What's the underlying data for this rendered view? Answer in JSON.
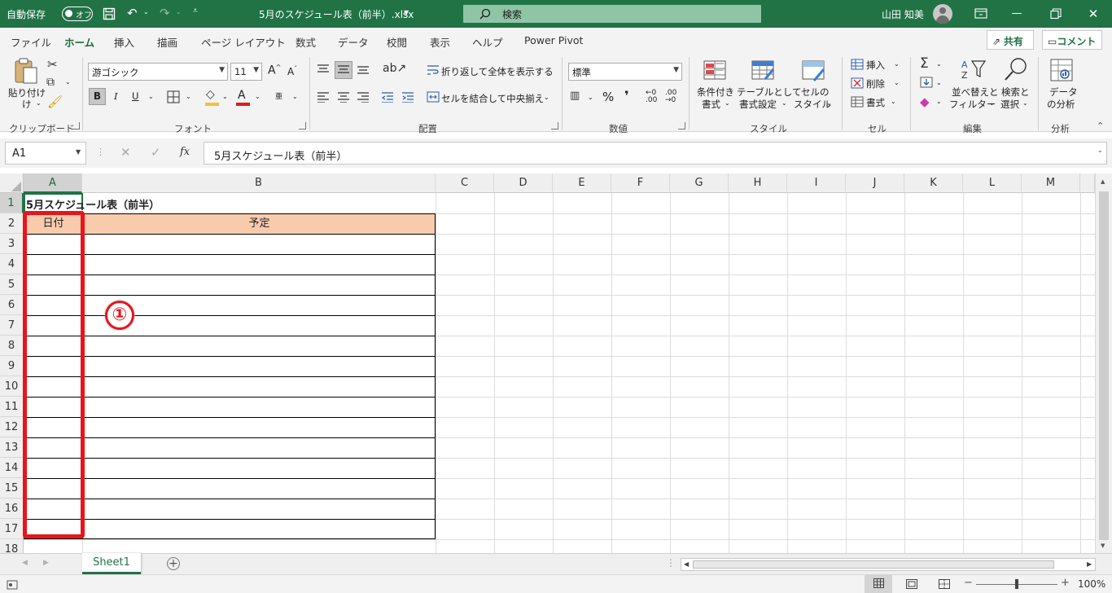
{
  "titlebar": {
    "autosave_label": "自動保存",
    "autosave_state": "オフ",
    "doc_title": "5月のスケジュール表（前半）.xlsx",
    "search_placeholder": "検索",
    "user_name": "山田 知美"
  },
  "menu": {
    "tabs": [
      "ファイル",
      "ホーム",
      "挿入",
      "描画",
      "ページ レイアウト",
      "数式",
      "データ",
      "校閲",
      "表示",
      "ヘルプ",
      "Power Pivot"
    ],
    "active_tab": "ホーム",
    "share_label": "共有",
    "comment_label": "コメント"
  },
  "ribbon": {
    "clipboard": {
      "paste_line1": "貼り付け",
      "paste_line2": "け",
      "group": "クリップボード"
    },
    "font": {
      "name": "游ゴシック",
      "size": "11",
      "group": "フォント",
      "bold": "B",
      "italic": "I",
      "underline": "U",
      "ruby": "亜"
    },
    "alignment": {
      "wrap": "折り返して全体を表示する",
      "merge": "セルを結合して中央揃え",
      "group": "配置"
    },
    "number": {
      "format": "標準",
      "group": "数値"
    },
    "styles": {
      "cond_line1": "条件付き",
      "cond_line2": "書式",
      "table_line1": "テーブルとして",
      "table_line2": "書式設定",
      "cell_line1": "セルの",
      "cell_line2": "スタイル",
      "group": "スタイル"
    },
    "cells": {
      "insert": "挿入",
      "delete": "削除",
      "format": "書式",
      "group": "セル"
    },
    "editing": {
      "sort_line1": "並べ替えと",
      "sort_line2": "フィルター",
      "find_line1": "検索と",
      "find_line2": "選択",
      "group": "編集"
    },
    "analysis": {
      "line1": "データ",
      "line2": "の分析",
      "group": "分析"
    }
  },
  "formula_bar": {
    "name_box": "A1",
    "fx_label": "fx",
    "content": "5月スケジュール表（前半）"
  },
  "sheet": {
    "columns": [
      "A",
      "B",
      "C",
      "D",
      "E",
      "F",
      "G",
      "H",
      "I",
      "J",
      "K",
      "L",
      "M"
    ],
    "rows": [
      "1",
      "2",
      "3",
      "4",
      "5",
      "6",
      "7",
      "8",
      "9",
      "10",
      "11",
      "12",
      "13",
      "14",
      "15",
      "16",
      "17",
      "18"
    ],
    "a1": "5月スケジュール表（前半）",
    "header_date": "日付",
    "header_plan": "予定",
    "header_fill": "#f8cbad",
    "annotation_marker": "①",
    "annotation_color": "#e8141b"
  },
  "sheet_tabs": {
    "active": "Sheet1"
  },
  "status": {
    "zoom": "100%"
  }
}
